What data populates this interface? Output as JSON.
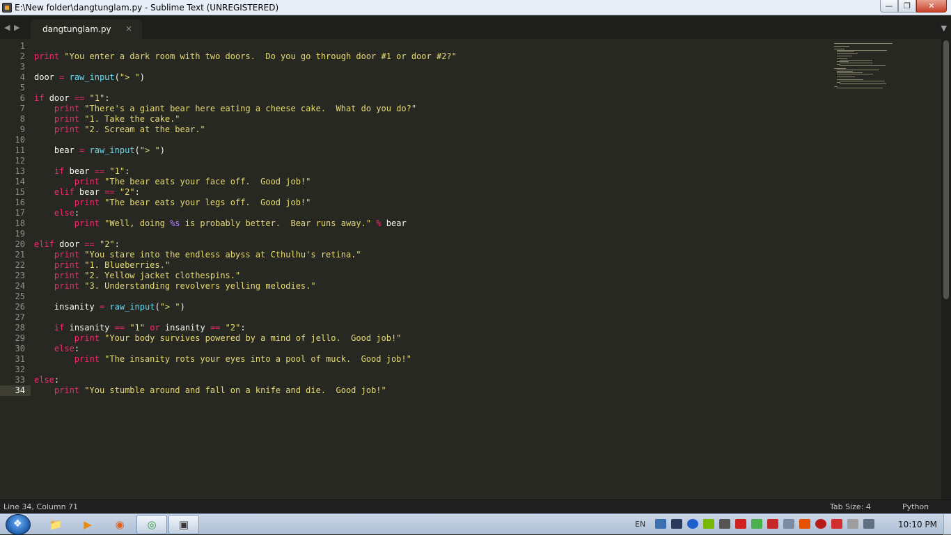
{
  "window": {
    "title": "E:\\New folder\\dangtunglam.py - Sublime Text (UNREGISTERED)",
    "controls": {
      "minimize": "—",
      "maximize": "❐",
      "close": "✕"
    }
  },
  "tabs": [
    {
      "label": "dangtunglam.py",
      "close": "×",
      "active": true
    }
  ],
  "nav": {
    "back": "◀",
    "forward": "▶",
    "dropdown": "▼"
  },
  "editor": {
    "language": "Python",
    "current_line": 34,
    "line_numbers": [
      "1",
      "2",
      "3",
      "4",
      "5",
      "6",
      "7",
      "8",
      "9",
      "10",
      "11",
      "12",
      "13",
      "14",
      "15",
      "16",
      "17",
      "18",
      "19",
      "20",
      "21",
      "22",
      "23",
      "24",
      "25",
      "26",
      "27",
      "28",
      "29",
      "30",
      "31",
      "32",
      "33",
      "34"
    ]
  },
  "code": {
    "l2_print": "print",
    "l2_str": "\"You enter a dark room with two doors.  Do you go through door #1 or door #2?\"",
    "l4_var": "door",
    "l4_eq": "=",
    "l4_fn": "raw_input",
    "l4_arg": "\"> \"",
    "l6_if": "if",
    "l6_var": "door",
    "l6_op": "==",
    "l6_str": "\"1\"",
    "l7_str": "\"There's a giant bear here eating a cheese cake.  What do you do?\"",
    "l8_str": "\"1. Take the cake.\"",
    "l9_str": "\"2. Scream at the bear.\"",
    "l11_var": "bear",
    "l13_var": "bear",
    "l14_str": "\"The bear eats your face off.  Good job!\"",
    "l15_elif": "elif",
    "l15_str": "\"2\"",
    "l16_str": "\"The bear eats your legs off.  Good job!\"",
    "l17_else": "else",
    "l18_str_a": "\"Well, doing ",
    "l18_fmt": "%s",
    "l18_str_b": " is probably better.  Bear runs away.\"",
    "l18_mod": "%",
    "l18_var": "bear",
    "l21_str": "\"You stare into the endless abyss at Cthulhu's retina.\"",
    "l22_str": "\"1. Blueberries.\"",
    "l23_str": "\"2. Yellow jacket clothespins.\"",
    "l24_str": "\"3. Understanding revolvers yelling melodies.\"",
    "l26_var": "insanity",
    "l28_or": "or",
    "l29_str": "\"Your body survives powered by a mind of jello.  Good job!\"",
    "l31_str": "\"The insanity rots your eyes into a pool of muck.  Good job!\"",
    "l34_str": "\"You stumble around and fall on a knife and die.  Good job!\""
  },
  "status": {
    "position": "Line 34, Column 71",
    "tab_size": "Tab Size: 4",
    "syntax": "Python"
  },
  "taskbar": {
    "apps": [
      {
        "icon": "folder-icon",
        "glyph": "📁"
      },
      {
        "icon": "media-player-icon",
        "glyph": "▶"
      },
      {
        "icon": "firefox-icon",
        "glyph": "◉"
      },
      {
        "icon": "green-app-icon",
        "glyph": "◎"
      },
      {
        "icon": "sublime-text-icon",
        "glyph": "▣"
      }
    ],
    "language": "EN",
    "clock": "10:10 PM"
  },
  "colors": {
    "background": "#272822",
    "keyword": "#f92672",
    "function": "#66d9ef",
    "string": "#e6db74",
    "format": "#ae81ff",
    "text": "#f8f8f2"
  }
}
